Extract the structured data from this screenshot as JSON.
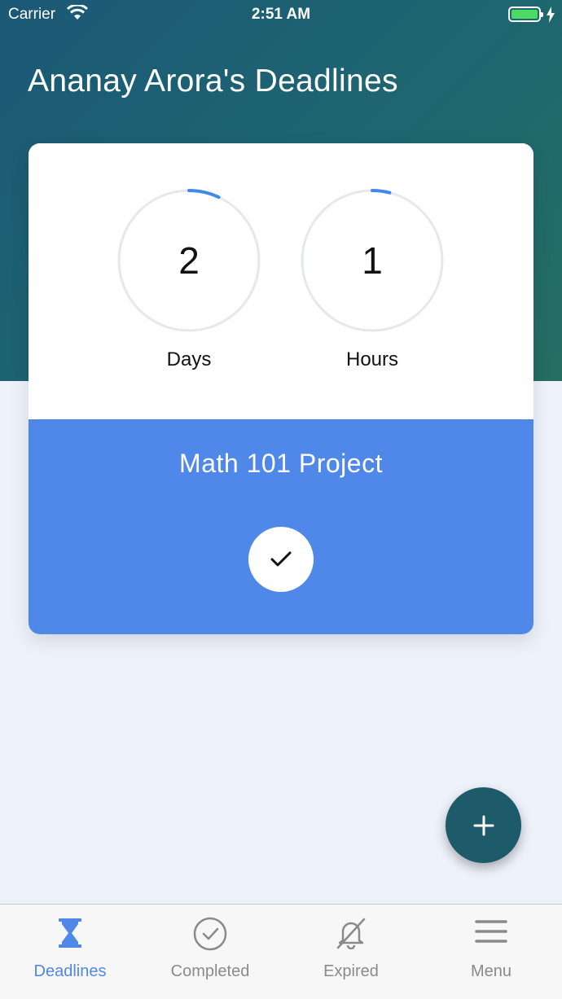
{
  "status_bar": {
    "carrier": "Carrier",
    "time": "2:51 AM",
    "battery_color": "#4cd964"
  },
  "header": {
    "title": "Ananay Arora's Deadlines",
    "gradient_colors": [
      "#1b5876",
      "#266e62"
    ]
  },
  "deadline_card": {
    "days": {
      "value": "2",
      "label": "Days",
      "progress_fraction": 0.07
    },
    "hours": {
      "value": "1",
      "label": "Hours",
      "progress_fraction": 0.04
    },
    "task_title": "Math 101 Project",
    "accent_color": "#4f88e8",
    "complete_icon": "checkmark-icon"
  },
  "fab": {
    "icon": "plus-icon",
    "color": "#1d5a6a"
  },
  "tab_bar": {
    "tabs": [
      {
        "label": "Deadlines",
        "icon": "hourglass-icon",
        "active": true
      },
      {
        "label": "Completed",
        "icon": "check-circle-icon",
        "active": false
      },
      {
        "label": "Expired",
        "icon": "bell-off-icon",
        "active": false
      },
      {
        "label": "Menu",
        "icon": "hamburger-menu-icon",
        "active": false
      }
    ]
  }
}
